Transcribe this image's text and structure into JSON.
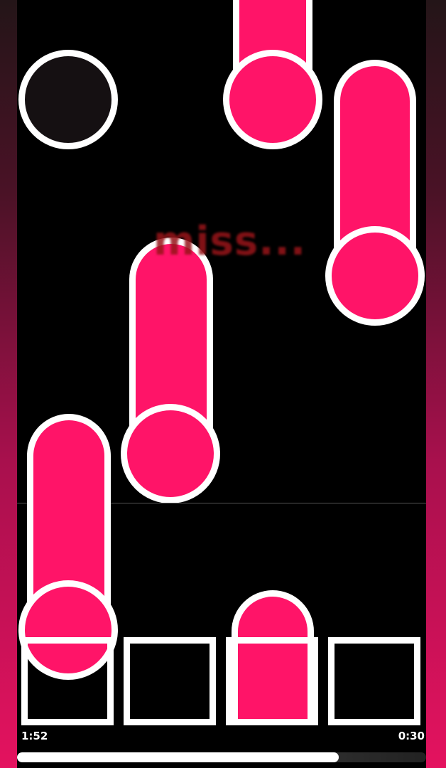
{
  "game": {
    "judgement_text": "miss...",
    "elapsed_time": "1:52",
    "remaining_time": "0:30",
    "progress_fraction": 0.787,
    "lanes": 4,
    "colors": {
      "note": "#ff1468",
      "outline": "#ffffff",
      "background": "#000000",
      "side_bar": "#e4125f",
      "judgement": "#96141a"
    }
  }
}
